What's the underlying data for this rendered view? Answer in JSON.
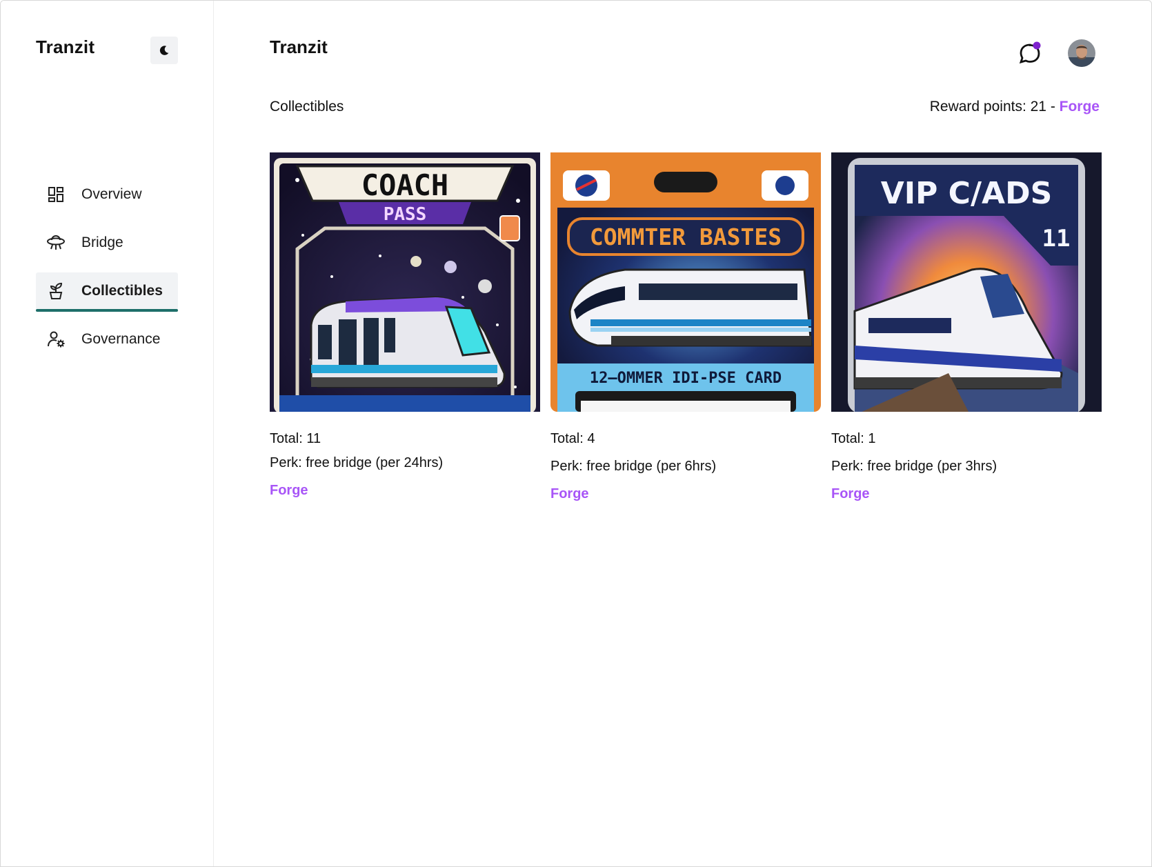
{
  "sidebar": {
    "brand": "Tranzit",
    "theme_icon": "moon-icon",
    "items": [
      {
        "label": "Overview",
        "icon": "grid-icon"
      },
      {
        "label": "Bridge",
        "icon": "bridge-ufo-icon"
      },
      {
        "label": "Collectibles",
        "icon": "plant-icon",
        "active": true
      },
      {
        "label": "Governance",
        "icon": "users-gear-icon"
      }
    ]
  },
  "header": {
    "title": "Tranzit",
    "notification_icon": "chat-bubble-icon",
    "avatar_icon": "user-avatar"
  },
  "main": {
    "section_label": "Collectibles",
    "reward_prefix": "Reward points: 21 - ",
    "reward_link": "Forge",
    "cards": [
      {
        "image_title": "COACH",
        "image_subtitle": "PASS",
        "total": "Total: 11",
        "perk": "Perk: free bridge (per 24hrs)",
        "forge": "Forge"
      },
      {
        "image_title": "COMMTER BASTES",
        "image_subtitle": "12—OMMER IDI-PSE CARD",
        "total": "Total: 4",
        "perk": "Perk: free bridge (per 6hrs)",
        "forge": "Forge"
      },
      {
        "image_title": "VIP C/ADS",
        "image_subtitle": "11",
        "total": "Total: 1",
        "perk": "Perk: free bridge (per 3hrs)",
        "forge": "Forge"
      }
    ]
  },
  "colors": {
    "accent": "#a855f7",
    "active_underline": "#1e6f6a",
    "notification_dot": "#7e22ce"
  }
}
